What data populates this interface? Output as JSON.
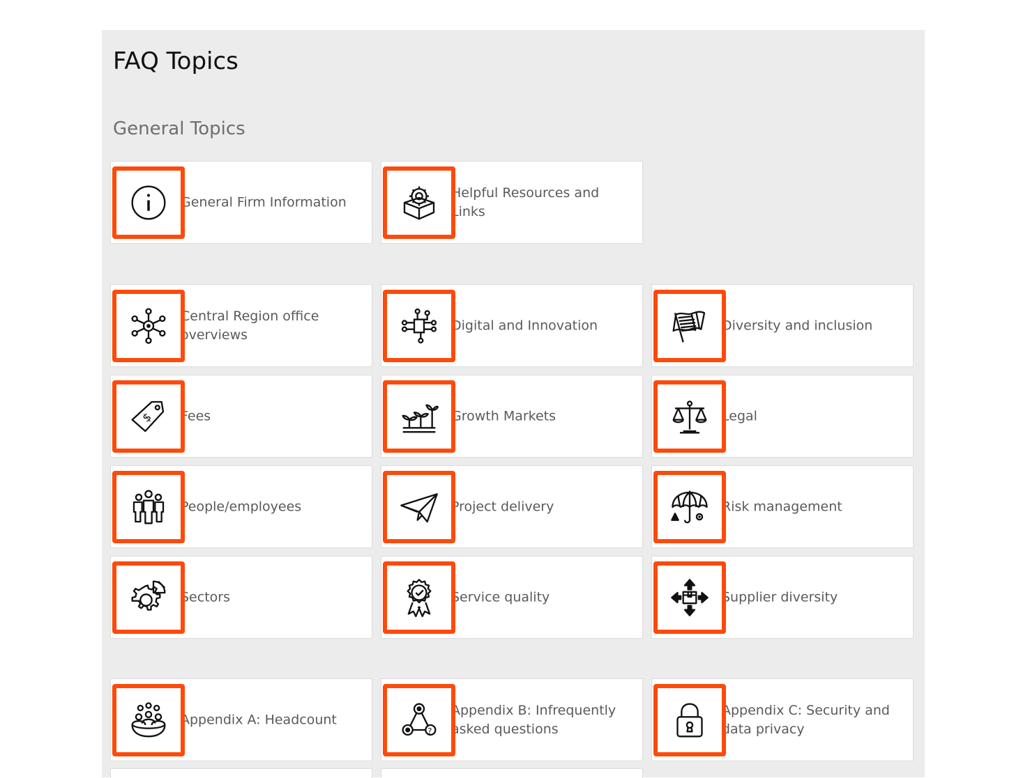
{
  "page": {
    "title": "FAQ Topics"
  },
  "sections": {
    "general": {
      "title": "General Topics"
    }
  },
  "cards": {
    "general_firm": {
      "label": "General Firm Information",
      "icon": "info-icon"
    },
    "helpful_resources": {
      "label": "Helpful Resources and Links",
      "icon": "gear-box-icon"
    },
    "central_region": {
      "label": "Central Region office overviews",
      "icon": "network-hub-icon"
    },
    "digital": {
      "label": "Digital and Innovation",
      "icon": "circuit-icon"
    },
    "diversity": {
      "label": "Diversity and inclusion",
      "icon": "flag-icon"
    },
    "fees": {
      "label": "Fees",
      "icon": "price-tag-icon"
    },
    "growth": {
      "label": "Growth Markets",
      "icon": "sprout-icon"
    },
    "legal": {
      "label": "Legal",
      "icon": "scales-icon"
    },
    "people": {
      "label": "People/employees",
      "icon": "people-icon"
    },
    "project": {
      "label": "Project delivery",
      "icon": "paper-plane-icon"
    },
    "risk": {
      "label": "Risk management",
      "icon": "umbrella-icon"
    },
    "sectors": {
      "label": "Sectors",
      "icon": "gear-chart-icon"
    },
    "service": {
      "label": "Service quality",
      "icon": "award-badge-icon"
    },
    "supplier": {
      "label": "Supplier diversity",
      "icon": "box-arrows-icon"
    },
    "appendix_a": {
      "label": "Appendix A: Headcount",
      "icon": "group-icon"
    },
    "appendix_b": {
      "label": "Appendix B: Infrequently asked questions",
      "icon": "question-network-icon"
    },
    "appendix_c": {
      "label": "Appendix C: Security and data privacy",
      "icon": "padlock-icon"
    }
  },
  "colors": {
    "accent": "#fe4a0a",
    "panel": "#ececec",
    "card": "#ffffff",
    "text": "#5a5a5a"
  }
}
